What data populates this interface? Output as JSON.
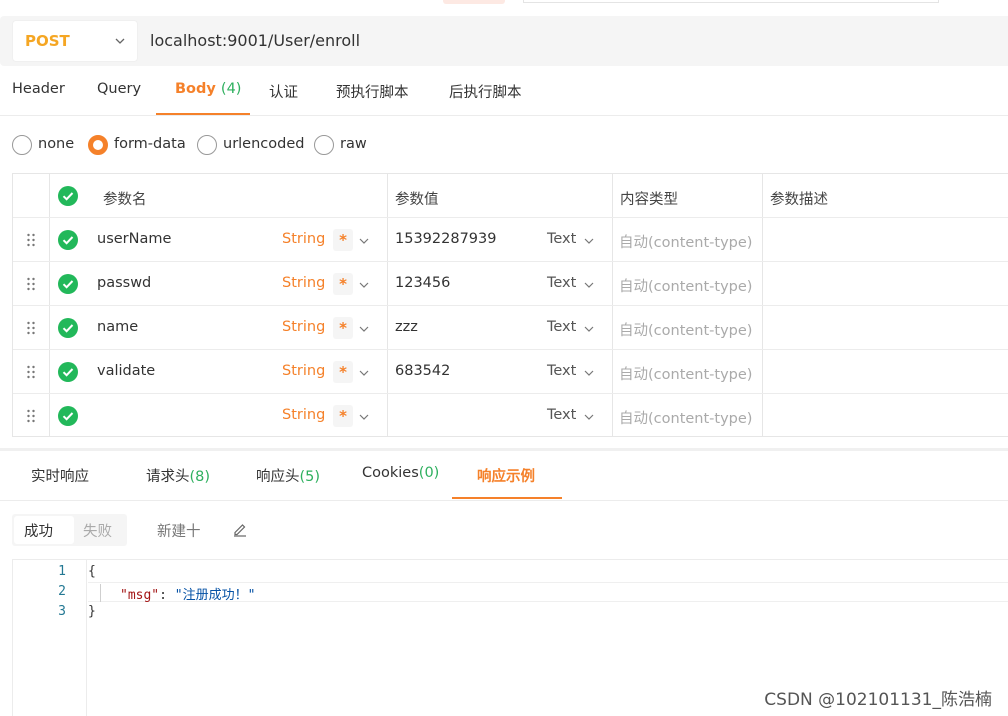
{
  "request": {
    "method": "POST",
    "url": "localhost:9001/User/enroll"
  },
  "request_tabs": [
    {
      "label": "Header",
      "count": ""
    },
    {
      "label": "Query",
      "count": ""
    },
    {
      "label": "Body",
      "count": "(4)"
    },
    {
      "label": "认证",
      "count": ""
    },
    {
      "label": "预执行脚本",
      "count": ""
    },
    {
      "label": "后执行脚本",
      "count": ""
    }
  ],
  "active_request_tab": "Body",
  "body_modes": [
    "none",
    "form-data",
    "urlencoded",
    "raw"
  ],
  "selected_body_mode": "form-data",
  "params_table": {
    "headers": [
      "参数名",
      "参数值",
      "内容类型",
      "参数描述"
    ],
    "rows": [
      {
        "key": "userName",
        "type": "String",
        "required": "*",
        "value": "15392287939",
        "value_type": "Text",
        "content_type": "自动(content-type)",
        "description": ""
      },
      {
        "key": "passwd",
        "type": "String",
        "required": "*",
        "value": "123456",
        "value_type": "Text",
        "content_type": "自动(content-type)",
        "description": ""
      },
      {
        "key": "name",
        "type": "String",
        "required": "*",
        "value": "zzz",
        "value_type": "Text",
        "content_type": "自动(content-type)",
        "description": ""
      },
      {
        "key": "validate",
        "type": "String",
        "required": "*",
        "value": "683542",
        "value_type": "Text",
        "content_type": "自动(content-type)",
        "description": ""
      },
      {
        "key": "",
        "type": "String",
        "required": "*",
        "value": "",
        "value_type": "Text",
        "content_type": "自动(content-type)",
        "description": ""
      }
    ]
  },
  "response_tabs": [
    {
      "label": "实时响应",
      "count": ""
    },
    {
      "label": "请求头",
      "count": "(8)"
    },
    {
      "label": "响应头",
      "count": "(5)"
    },
    {
      "label": "Cookies",
      "count": "(0)"
    },
    {
      "label": "响应示例",
      "count": ""
    }
  ],
  "active_response_tab": "响应示例",
  "example_segments": {
    "success": "成功",
    "fail": "失败"
  },
  "new_button": "新建十",
  "code_lines": {
    "numbers": [
      "1",
      "2",
      "3"
    ],
    "open_brace": "{",
    "key": "\"msg\"",
    "colon": ": ",
    "value": "\"注册成功！\"",
    "close_brace": "}"
  },
  "watermark": "CSDN @102101131_陈浩楠",
  "colors": {
    "accent": "#f5812a",
    "method": "#f5a623",
    "count_green": "#2fb05f",
    "check_green": "#22b85a"
  }
}
